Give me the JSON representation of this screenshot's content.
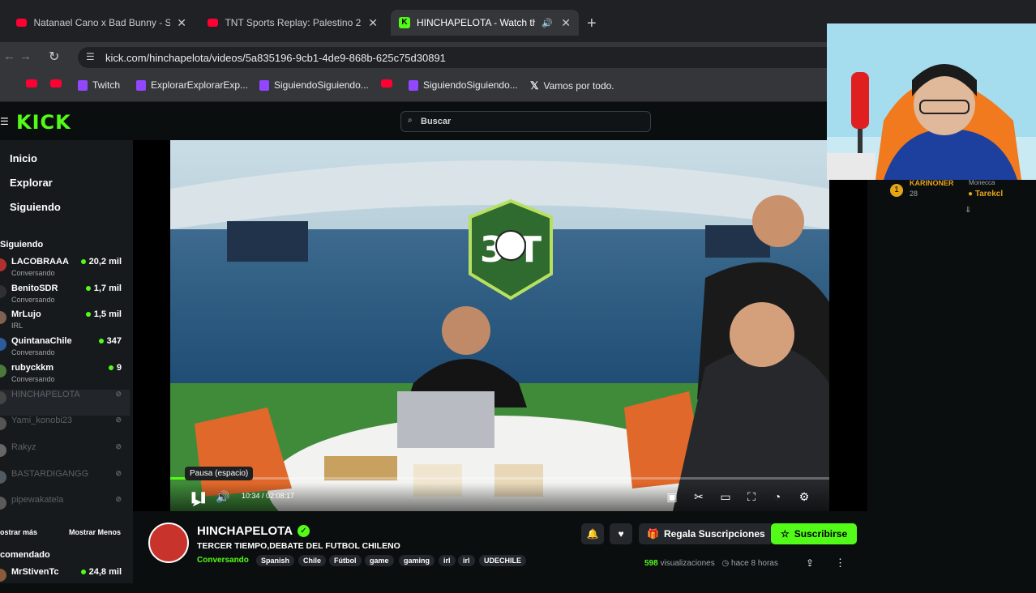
{
  "browser": {
    "tabs": [
      {
        "title": "Natanael Cano x Bad Bunny - S",
        "favicon": "youtube-icon",
        "active": false
      },
      {
        "title": "TNT Sports Replay: Palestino 2",
        "favicon": "youtube-icon",
        "active": false
      },
      {
        "title": "HINCHAPELOTA - Watch th",
        "favicon": "kick-icon",
        "active": true
      }
    ],
    "url": "kick.com/hinchapelota/videos/5a835196-9cb1-4de9-868b-625c75d30891",
    "bookmarks": [
      {
        "label": "",
        "icon": "youtube-icon"
      },
      {
        "label": "",
        "icon": "youtube-icon"
      },
      {
        "label": "Twitch",
        "icon": "twitch-icon"
      },
      {
        "label": "ExplorarExplorarExp...",
        "icon": "twitch-icon"
      },
      {
        "label": "SiguiendoSiguiendo...",
        "icon": "twitch-icon"
      },
      {
        "label": "",
        "icon": "youtube-icon"
      },
      {
        "label": "SiguiendoSiguiendo...",
        "icon": "twitch-icon"
      },
      {
        "label": "Vamos por todo.",
        "icon": "x-icon"
      }
    ]
  },
  "kick": {
    "logo": "KICK",
    "search_placeholder": "Buscar"
  },
  "sidebar": {
    "nav": [
      "Inicio",
      "Explorar",
      "Siguiendo"
    ],
    "following_header": "Siguiendo",
    "channels": [
      {
        "name": "LACOBRAAA",
        "sub": "Conversando",
        "viewers": "20,2 mil",
        "live": true
      },
      {
        "name": "BenitoSDR",
        "sub": "Conversando",
        "viewers": "1,7 mil",
        "live": true
      },
      {
        "name": "MrLujo",
        "sub": "IRL",
        "viewers": "1,5 mil",
        "live": true
      },
      {
        "name": "QuintanaChile",
        "sub": "Conversando",
        "viewers": "347",
        "live": true
      },
      {
        "name": "rubyckkm",
        "sub": "Conversando",
        "viewers": "9",
        "live": true
      },
      {
        "name": "HINCHAPELOTA",
        "sub": "",
        "viewers": "",
        "live": false
      },
      {
        "name": "Yami_konobi23",
        "sub": "",
        "viewers": "",
        "live": false
      },
      {
        "name": "Rakyz",
        "sub": "",
        "viewers": "",
        "live": false
      },
      {
        "name": "BASTARDIGANGG",
        "sub": "",
        "viewers": "",
        "live": false
      },
      {
        "name": "pipewakatela",
        "sub": "",
        "viewers": "",
        "live": false
      }
    ],
    "show_more": "ostrar más",
    "show_less": "Mostrar Menos",
    "recommended_header": "comendado",
    "recommended": [
      {
        "name": "MrStivenTc",
        "viewers": "24,8 mil"
      }
    ]
  },
  "player": {
    "tooltip": "Pausa (espacio)",
    "time": "10:34 / 02:08:17",
    "progress": 0.082
  },
  "video_info": {
    "channel": "HINCHAPELOTA",
    "title": "TERCER TIEMPO,DEBATE DEL FUTBOL CHILENO",
    "category": "Conversando",
    "tags": [
      "Spanish",
      "Chile",
      "Fútbol",
      "game",
      "gaming",
      "irl",
      "irl",
      "UDECHILE"
    ],
    "gift_label": "Regala Suscripciones",
    "subscribe_label": "Suscribirse",
    "views_count": "598",
    "views_label": "visualizaciones",
    "time_ago": "hace 8 horas"
  },
  "chat": {
    "user1": "KARINONER",
    "user1_badge": "28",
    "user2": "Tarekcl",
    "user_top": "Monecca"
  },
  "colors": {
    "kick_green": "#53fc18",
    "youtube_red": "#ff0033",
    "twitch_purple": "#9146ff"
  }
}
